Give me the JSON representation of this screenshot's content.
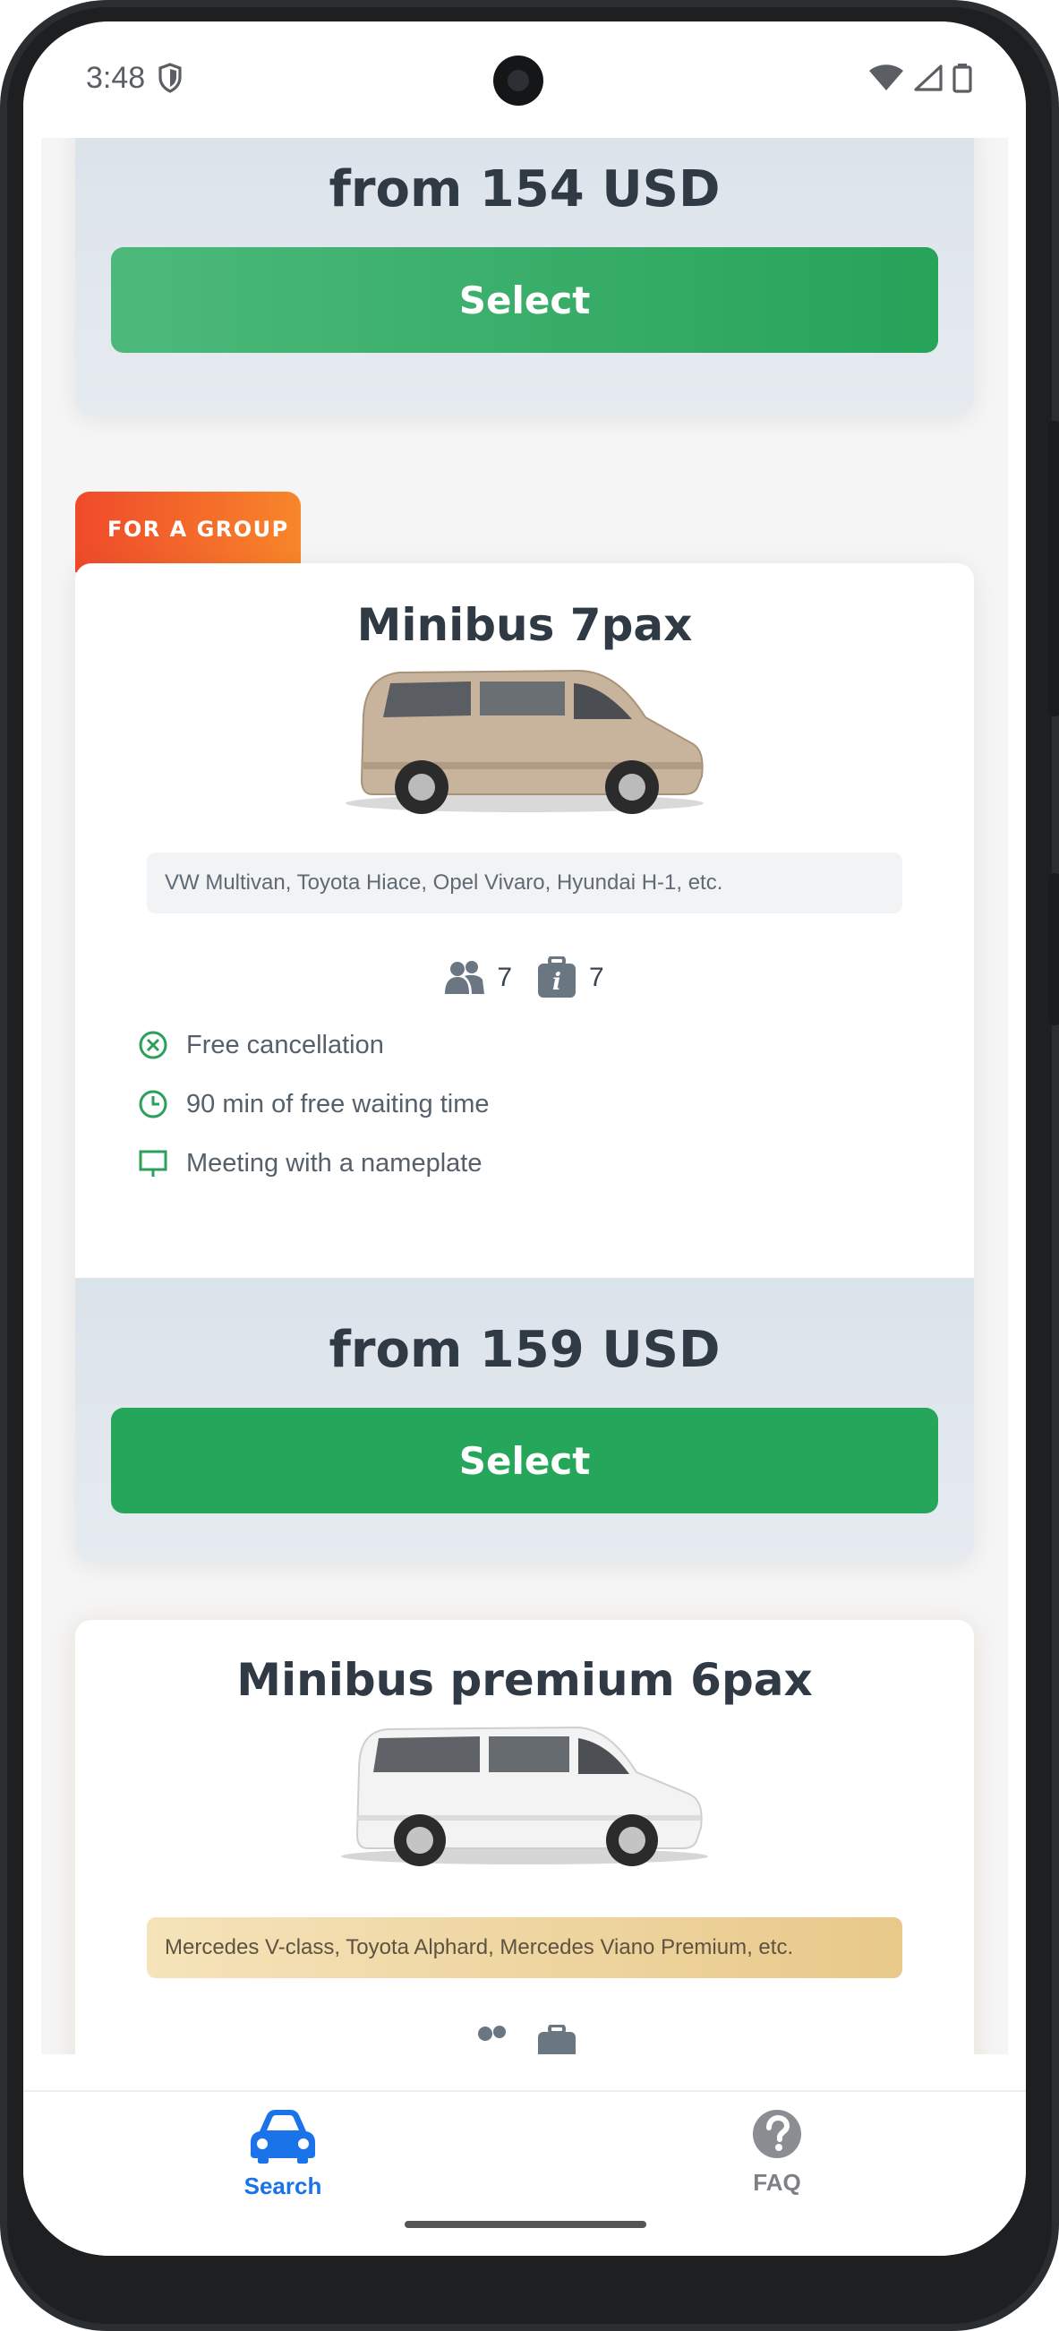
{
  "status_bar": {
    "time": "3:48"
  },
  "cards": [
    {
      "price": "from 154 USD",
      "select_label": "Select"
    },
    {
      "badge": "FOR A GROUP",
      "title": "Minibus 7pax",
      "vehicle_color": "#c8b49c",
      "models": "VW Multivan, Toyota Hiace, Opel Vivaro, Hyundai H-1, etc.",
      "passengers": "7",
      "luggage": "7",
      "features": [
        {
          "icon": "cancel-circle-icon",
          "label": "Free cancellation"
        },
        {
          "icon": "clock-icon",
          "label": "90 min of free waiting time"
        },
        {
          "icon": "nameplate-icon",
          "label": "Meeting with a nameplate"
        }
      ],
      "price": "from 159 USD",
      "select_label": "Select"
    },
    {
      "title": "Minibus premium 6pax",
      "vehicle_color": "#f3f3f3",
      "models": "Mercedes V-class, Toyota Alphard, Mercedes Viano Premium, etc."
    }
  ],
  "bottom_nav": [
    {
      "label": "Search",
      "icon": "car-icon",
      "active": true
    },
    {
      "label": "FAQ",
      "icon": "question-circle-icon",
      "active": false
    }
  ],
  "colors": {
    "accent_blue": "#1a73e8",
    "green": "#26a65b",
    "badge_orange": "#f06a2b",
    "feature_green": "#2aa05a",
    "text_dark": "#2f3a45"
  }
}
